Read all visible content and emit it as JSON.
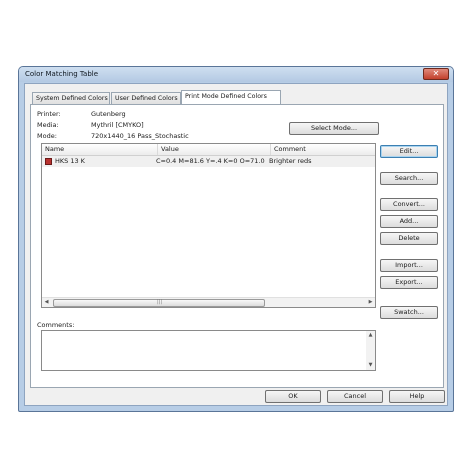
{
  "window": {
    "title": "Color Matching Table",
    "close_glyph": "✕"
  },
  "tabs": [
    {
      "label": "System Defined Colors"
    },
    {
      "label": "User Defined Colors"
    },
    {
      "label": "Print Mode Defined Colors"
    }
  ],
  "info": {
    "printer_label": "Printer:",
    "printer_value": "Gutenberg",
    "media_label": "Media:",
    "media_value": "Mythril [CMYKO]",
    "mode_label": "Mode:",
    "mode_value": "720x1440_16 Pass_Stochastic"
  },
  "select_mode_label": "Select Mode...",
  "table": {
    "columns": [
      "Name",
      "Value",
      "Comment"
    ],
    "rows": [
      {
        "name": "HKS 13 K",
        "value": "C=0.4 M=81.6 Y=.4 K=0 O=71.0",
        "comment": "Brighter reds",
        "swatch": "#b8312f"
      }
    ]
  },
  "scrollbar": {
    "left_arrow": "◀",
    "right_arrow": "▶",
    "grip": "|||",
    "up_arrow": "▲",
    "down_arrow": "▼"
  },
  "side_buttons": {
    "edit": "Edit...",
    "search": "Search...",
    "convert": "Convert...",
    "add": "Add...",
    "delete": "Delete",
    "import": "Import...",
    "export": "Export...",
    "swatch": "Swatch..."
  },
  "comments_label": "Comments:",
  "footer": {
    "ok": "OK",
    "cancel": "Cancel",
    "help": "Help"
  }
}
